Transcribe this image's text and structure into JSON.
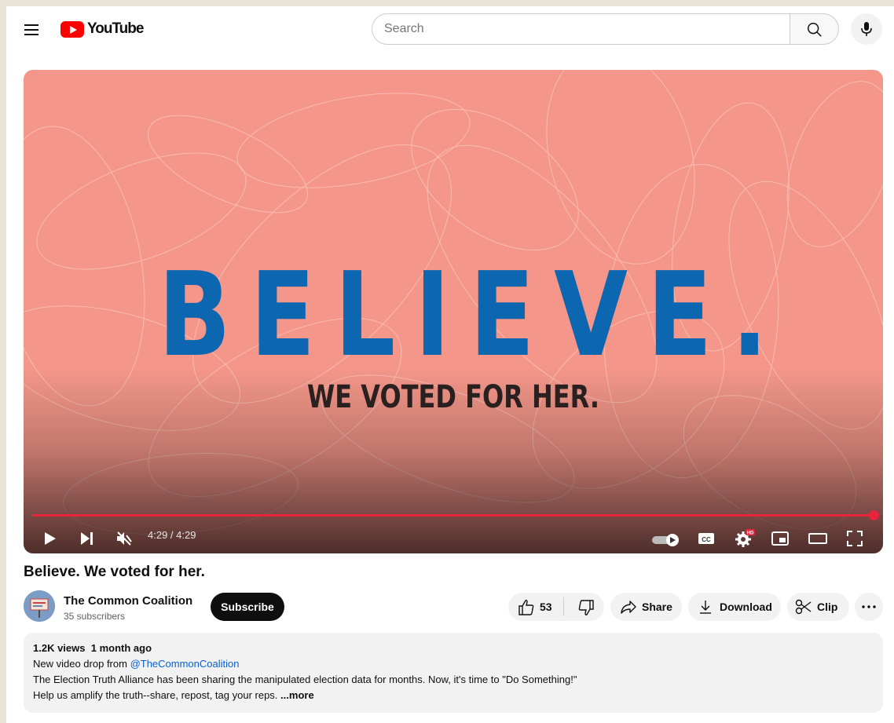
{
  "header": {
    "logo_text": "YouTube",
    "search_placeholder": "Search"
  },
  "player": {
    "headline": "BELIEVE.",
    "subline": "WE VOTED FOR HER.",
    "time_display": "4:29 / 4:29",
    "progress_fraction": 1.0,
    "hd_badge": "HD",
    "colors": {
      "background": "#f4978a",
      "headline": "#0c66b0",
      "subline": "#2a2020",
      "progress": "#e8233d"
    }
  },
  "video": {
    "title": "Believe. We voted for her."
  },
  "channel": {
    "name": "The Common Coalition",
    "subscribers": "35 subscribers",
    "subscribe_label": "Subscribe"
  },
  "actions": {
    "like_count": "53",
    "share_label": "Share",
    "download_label": "Download",
    "clip_label": "Clip"
  },
  "description": {
    "views": "1.2K views",
    "date": "1 month ago",
    "line1_prefix": "New video drop from ",
    "line1_mention": "@TheCommonCoalition",
    "line2": "The Election Truth Alliance has been sharing the manipulated election data for months. Now, it's time to \"Do Something!\"",
    "line3": "Help us amplify the truth--share, repost, tag your reps.",
    "more_label": "...more"
  },
  "icons": {
    "menu": "hamburger-icon",
    "search": "search-icon",
    "mic": "mic-icon",
    "play": "play-icon",
    "next": "next-icon",
    "mute": "mute-icon",
    "autoplay": "autoplay-toggle-icon",
    "captions": "cc-icon",
    "settings": "gear-icon",
    "miniplayer": "miniplayer-icon",
    "theater": "theater-icon",
    "fullscreen": "fullscreen-icon",
    "like": "thumbs-up-icon",
    "dislike": "thumbs-down-icon",
    "share": "share-icon",
    "download": "download-icon",
    "clip": "scissors-icon",
    "more": "more-icon"
  }
}
